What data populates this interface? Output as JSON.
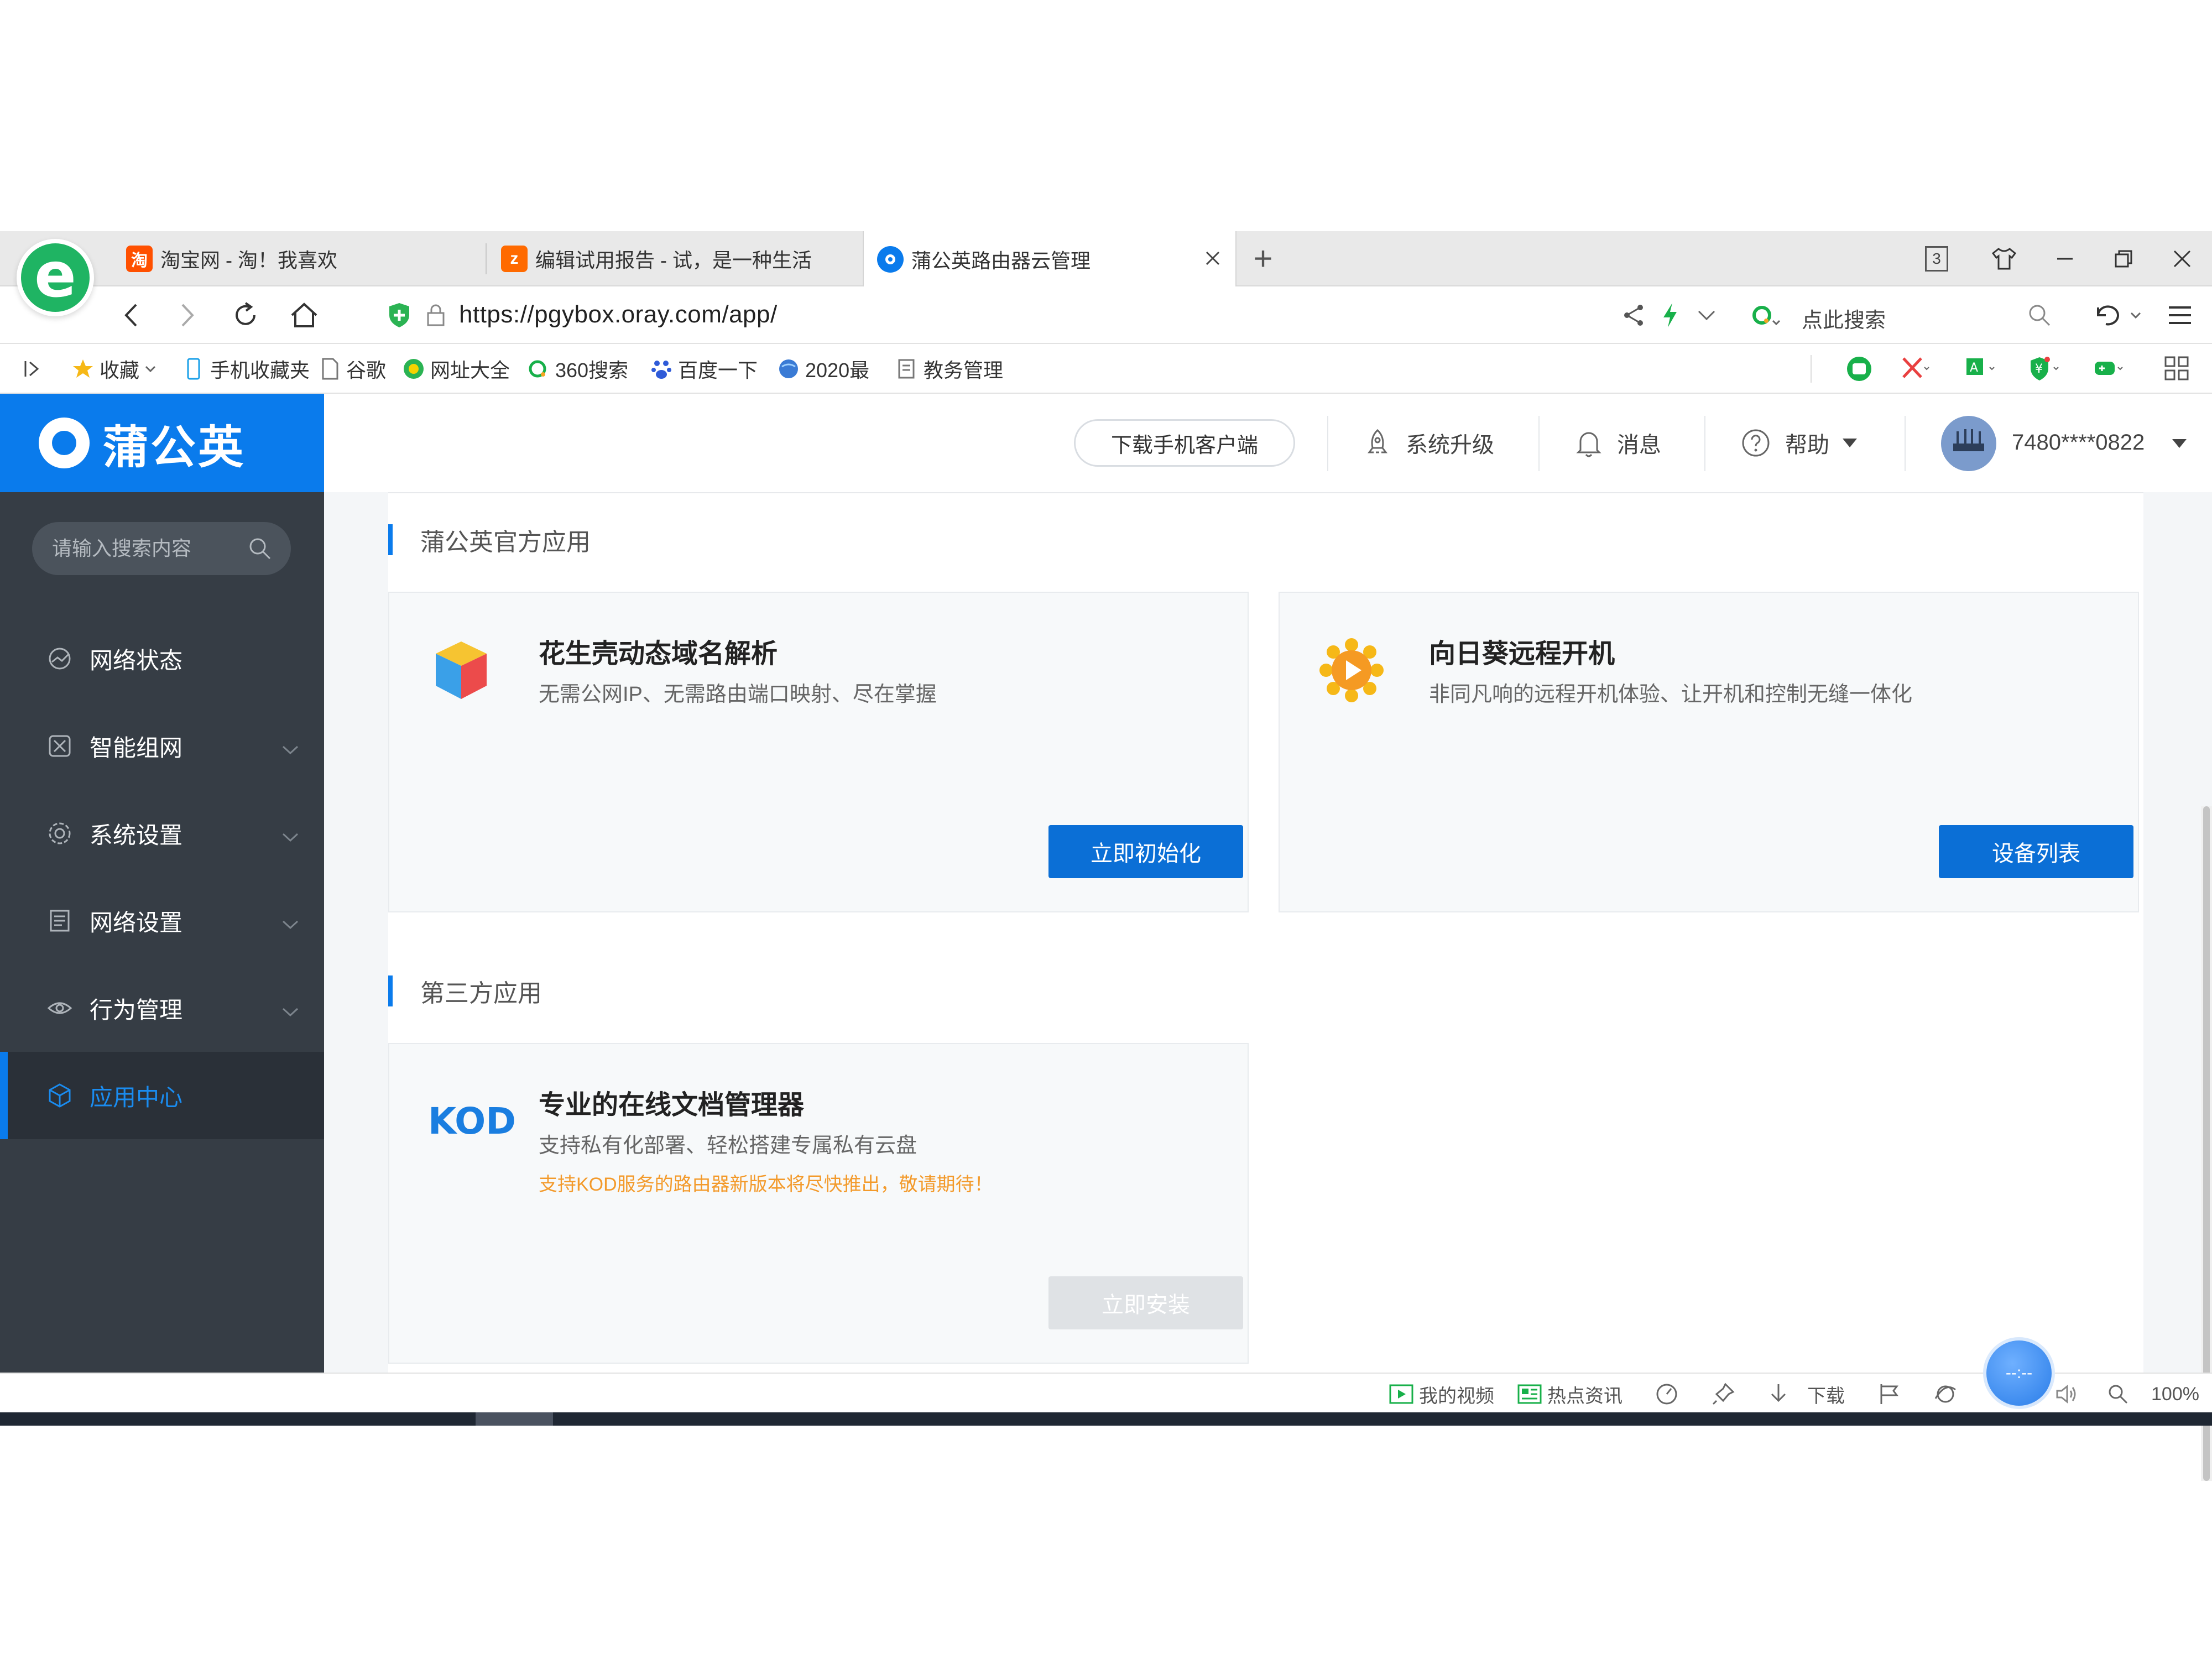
{
  "browser": {
    "tabs": [
      {
        "title": "淘宝网 - 淘！我喜欢",
        "favicon_color": "#ff5000",
        "favicon_glyph": "淘"
      },
      {
        "title": "编辑试用报告 - 试，是一种生活",
        "favicon_color": "#ff6a00",
        "favicon_glyph": "z"
      },
      {
        "title": "蒲公英路由器云管理",
        "favicon_color": "#0a7bec",
        "favicon_glyph": ""
      }
    ],
    "new_tab_symbol": "+",
    "tab_count": "3",
    "url": "https://pgybox.oray.com/app/",
    "search_placeholder": "点此搜索",
    "bookmarks": [
      {
        "label": "收藏",
        "icon": "star-icon"
      },
      {
        "label": "手机收藏夹",
        "icon": "phone-icon"
      },
      {
        "label": "谷歌",
        "icon": "page-icon"
      },
      {
        "label": "网址大全",
        "icon": "web-directory-icon"
      },
      {
        "label": "360搜索",
        "icon": "search-360-icon"
      },
      {
        "label": "百度一下",
        "icon": "baidu-paw-icon"
      },
      {
        "label": "2020最",
        "icon": "globe-icon"
      },
      {
        "label": "教务管理",
        "icon": "document-icon"
      }
    ],
    "status": {
      "my_video": "我的视频",
      "hot_news": "热点资讯",
      "download": "下载",
      "zoom": "100%",
      "float_ball": "--:--"
    }
  },
  "app": {
    "brand": "蒲公英",
    "sidebar": {
      "search_placeholder": "请输入搜索内容",
      "items": [
        {
          "label": "网络状态",
          "has_chevron": false
        },
        {
          "label": "智能组网",
          "has_chevron": true
        },
        {
          "label": "系统设置",
          "has_chevron": true
        },
        {
          "label": "网络设置",
          "has_chevron": true
        },
        {
          "label": "行为管理",
          "has_chevron": true
        },
        {
          "label": "应用中心",
          "has_chevron": false,
          "active": true
        }
      ]
    },
    "topbar": {
      "download_app": "下载手机客户端",
      "upgrade": "系统升级",
      "messages": "消息",
      "help": "帮助",
      "user": "7480****0822"
    },
    "sections": [
      {
        "title": "蒲公英官方应用",
        "cards": [
          {
            "title": "花生壳动态域名解析",
            "desc": "无需公网IP、无需路由端口映射、尽在掌握",
            "button": "立即初始化",
            "icon": "peanut-shell-cube-icon"
          },
          {
            "title": "向日葵远程开机",
            "desc": "非同凡响的远程开机体验、让开机和控制无缝一体化",
            "button": "设备列表",
            "icon": "sunflower-icon"
          }
        ]
      },
      {
        "title": "第三方应用",
        "cards": [
          {
            "title": "专业的在线文档管理器",
            "desc": "支持私有化部署、轻松搭建专属私有云盘",
            "note": "支持KOD服务的路由器新版本将尽快推出，敬请期待！",
            "button": "立即安装",
            "icon": "kod-logo-icon",
            "logo_text": "KOD",
            "disabled": true
          }
        ]
      }
    ]
  },
  "colors": {
    "brand_blue": "#0a7bec",
    "sidebar_bg": "#363d45",
    "button_blue": "#0b6fd6",
    "note_orange": "#f39a2b"
  }
}
